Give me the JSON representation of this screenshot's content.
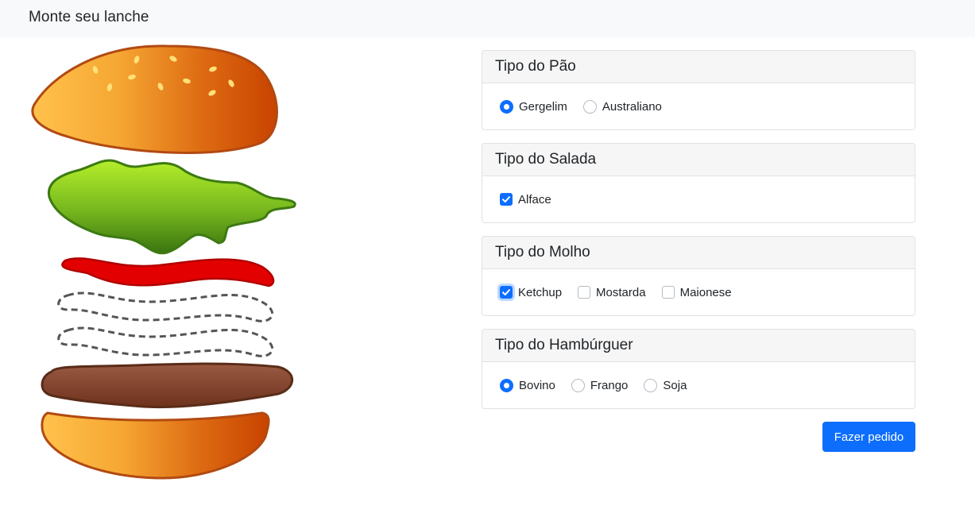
{
  "navbar": {
    "brand": "Monte seu lanche"
  },
  "burger": {
    "layers": [
      "top-bun",
      "lettuce",
      "ketchup",
      "mustard-placeholder",
      "mayonnaise-placeholder",
      "patty",
      "bottom-bun"
    ]
  },
  "sections": {
    "pao": {
      "title": "Tipo do Pão",
      "options": [
        {
          "label": "Gergelim",
          "checked": true
        },
        {
          "label": "Australiano",
          "checked": false
        }
      ]
    },
    "salada": {
      "title": "Tipo do Salada",
      "options": [
        {
          "label": "Alface",
          "checked": true
        }
      ]
    },
    "molho": {
      "title": "Tipo do Molho",
      "options": [
        {
          "label": "Ketchup",
          "checked": true
        },
        {
          "label": "Mostarda",
          "checked": false
        },
        {
          "label": "Maionese",
          "checked": false
        }
      ]
    },
    "hamburguer": {
      "title": "Tipo do Hambúrguer",
      "options": [
        {
          "label": "Bovino",
          "checked": true
        },
        {
          "label": "Frango",
          "checked": false
        },
        {
          "label": "Soja",
          "checked": false
        }
      ]
    }
  },
  "actions": {
    "order_label": "Fazer pedido"
  },
  "colors": {
    "primary": "#0d6efd",
    "bun_light": "#ffbe46",
    "bun_dark": "#c84300",
    "lettuce": "#7bbf1c",
    "ketchup": "#e00000",
    "patty": "#7a3d25"
  }
}
